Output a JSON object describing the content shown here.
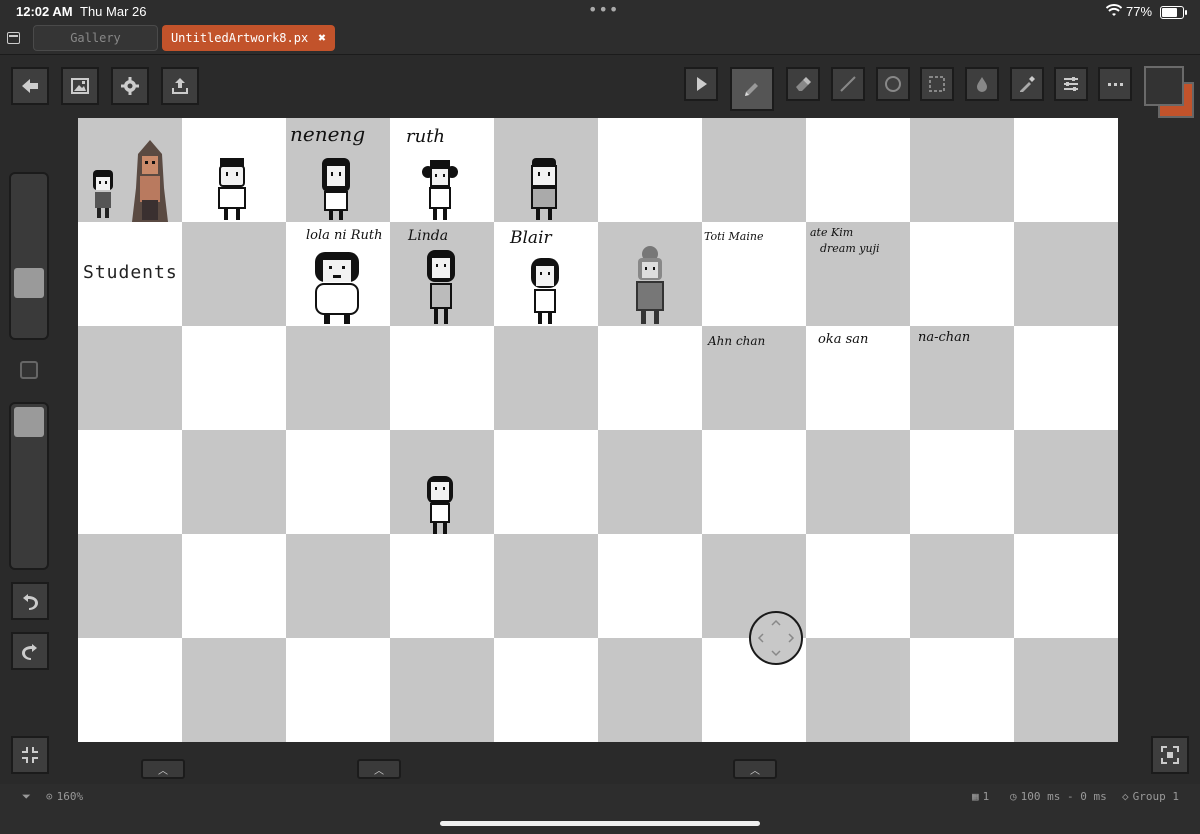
{
  "status": {
    "time": "12:02 AM",
    "date": "Thu Mar 26",
    "battery": "77%",
    "battery_level": 0.77
  },
  "tabs": {
    "gallery": "Gallery",
    "file": "UntitledArtwork8.px",
    "close": "✖"
  },
  "canvas": {
    "zoom": "160%",
    "students_label": "Students",
    "names": [
      "neneng",
      "ruth",
      "lola ni Ruth",
      "Linda",
      "Blair",
      "Toti Maine",
      "ate Kim",
      "dream yuji",
      "Ahn chan",
      "oka san",
      "na-chan"
    ]
  },
  "footer": {
    "frames": "1",
    "timing": "100 ms - 0 ms",
    "group": "Group 1"
  },
  "colors": {
    "accent": "#c2532b",
    "canvas_gray": "#c6c6c6"
  }
}
